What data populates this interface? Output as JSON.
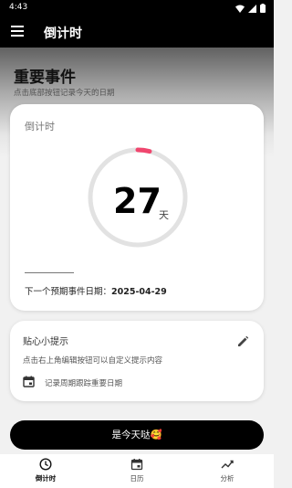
{
  "status_bar": {
    "time": "4:43"
  },
  "app_bar": {
    "title": "倒计时"
  },
  "header": {
    "title": "重要事件",
    "subtitle": "点击底部按钮记录今天的日期"
  },
  "countdown_card": {
    "label": "倒计时",
    "count": "27",
    "unit": "天",
    "progress_fraction": 0.04,
    "next_date_label": "下一个预期事件日期：",
    "next_date_value": "2025-04-29"
  },
  "tip_card": {
    "title": "贴心小提示",
    "text": "点击右上角编辑按钮可以自定义提示内容",
    "note": "记录周期跟踪重要日期"
  },
  "action_button": {
    "label": "是今天哒🥰"
  },
  "bottom_nav": {
    "items": [
      {
        "label": "倒计时",
        "icon": "clock-icon",
        "active": true
      },
      {
        "label": "日历",
        "icon": "calendar-icon",
        "active": false
      },
      {
        "label": "分析",
        "icon": "trend-icon",
        "active": false
      }
    ]
  },
  "colors": {
    "accent": "#f0466e",
    "ring_track": "#e2e2e2",
    "primary": "#000000"
  }
}
